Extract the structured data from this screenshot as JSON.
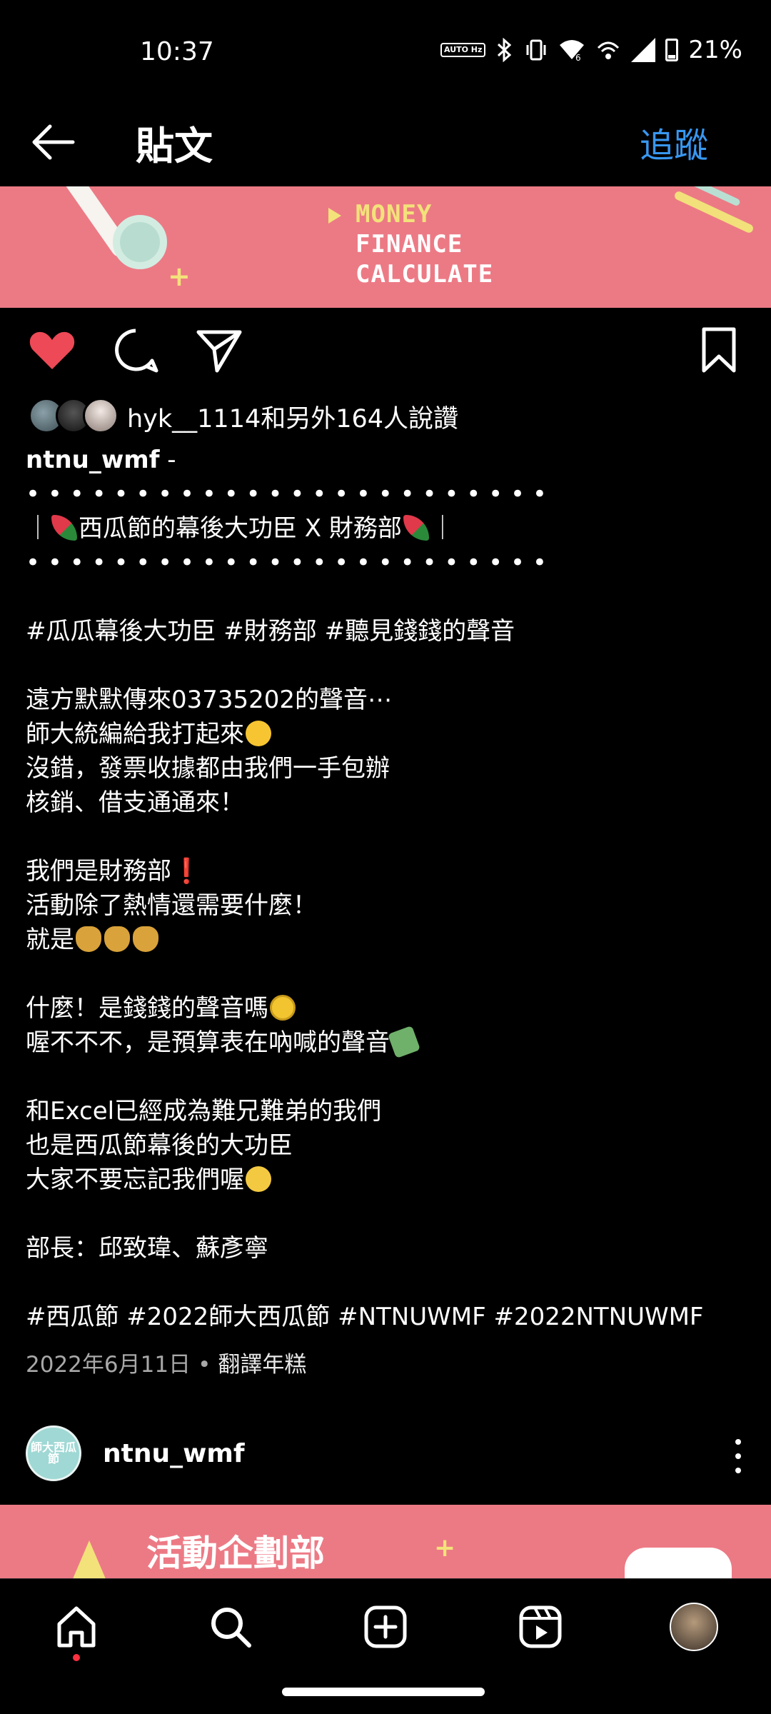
{
  "status_bar": {
    "time": "10:37",
    "battery_percent": "21%",
    "icons": [
      "auto-hz-icon",
      "bluetooth-icon",
      "vibrate-icon",
      "wifi-6-icon",
      "hotspot-icon",
      "signal-icon",
      "battery-icon"
    ],
    "auto_label": "AUTO Hz"
  },
  "header": {
    "title": "貼文",
    "follow_label": "追蹤"
  },
  "post": {
    "banner": {
      "line1": "MONEY",
      "line2": "FINANCE",
      "line3": "CALCULATE"
    },
    "liked": true,
    "likes_text": "hyk__1114和另外164人說讚",
    "author": "ntnu_wmf",
    "author_suffix": " -",
    "dots_line": "• • • • • • • • • • • • • • • • • • • • • • • •",
    "caption_title_pre": "｜",
    "caption_title": "西瓜節的幕後大功臣 X 財務部",
    "caption_title_post": "｜",
    "lines": {
      "tags1": "#瓜瓜幕後大功臣 #財務部 #聽見錢錢的聲音",
      "l1": "遠方默默傳來03735202的聲音⋯",
      "l2": "師大統編給我打起來",
      "l3": "沒錯，發票收據都由我們一手包辦",
      "l4": "核銷、借支通通來！",
      "l5": "我們是財務部",
      "l6": "活動除了熱情還需要什麼！",
      "l7": "就是",
      "l8": "什麼！是錢錢的聲音嗎",
      "l9": "喔不不不，是預算表在吶喊的聲音",
      "l10": "和Excel已經成為難兄難弟的我們",
      "l11": "也是西瓜節幕後的大功臣",
      "l12": "大家不要忘記我們喔",
      "l13": "部長：邱致瑋、蘇彥寧",
      "tags2": "#西瓜節 #2022師大西瓜節 #NTNUWMF #2022NTNUWMF"
    },
    "exclamation": "❗",
    "date": "2022年6月11日",
    "separator": "•",
    "translate_label": "翻譯年糕"
  },
  "next_post": {
    "author": "ntnu_wmf",
    "avatar_text": "師大西瓜節",
    "banner_title": "活動企劃部"
  },
  "bottom_nav": {
    "items": [
      "home-icon",
      "search-icon",
      "create-icon",
      "reels-icon",
      "profile-avatar"
    ],
    "active": "home-icon"
  },
  "colors": {
    "accent_blue": "#3897f0",
    "like_red": "#ed4956",
    "banner_pink": "#ec7a85"
  }
}
